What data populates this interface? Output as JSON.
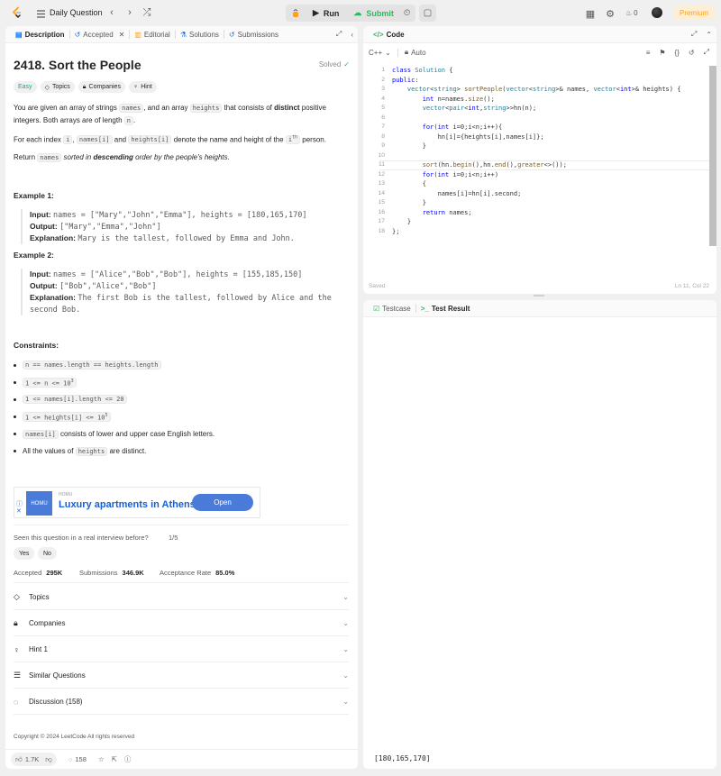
{
  "topbar": {
    "title": "Daily Question",
    "run_label": "Run",
    "submit_label": "Submit",
    "streak_count": "0",
    "premium_label": "Premium"
  },
  "left_tabs": [
    {
      "label": "Description"
    },
    {
      "label": "Accepted"
    },
    {
      "label": "Editorial"
    },
    {
      "label": "Solutions"
    },
    {
      "label": "Submissions"
    }
  ],
  "problem": {
    "title": "2418. Sort the People",
    "solved": "Solved",
    "difficulty": "Easy",
    "chip_topics": "Topics",
    "chip_companies": "Companies",
    "chip_hint": "Hint",
    "p1_a": "You are given an array of strings ",
    "p1_names": "names",
    "p1_b": ", and an array ",
    "p1_heights": "heights",
    "p1_c": " that consists of ",
    "p1_distinct": "distinct",
    "p1_d": " positive integers. Both arrays are of length ",
    "p1_n": "n",
    "p1_e": ".",
    "p2_a": "For each index ",
    "p2_i": "i",
    "p2_b": ", ",
    "p2_namesi": "names[i]",
    "p2_c": " and ",
    "p2_heightsi": "heights[i]",
    "p2_d": " denote the name and height of the ",
    "p2_ith": "i",
    "p2_th": "th",
    "p2_e": " person.",
    "p3_a": "Return ",
    "p3_names": "names",
    "p3_b": " sorted in ",
    "p3_desc": "descending",
    "p3_c": " order by the people's heights."
  },
  "examples": [
    {
      "heading": "Example 1:",
      "input_label": "Input:",
      "input": "names = [\"Mary\",\"John\",\"Emma\"], heights = [180,165,170]",
      "output_label": "Output:",
      "output": "[\"Mary\",\"Emma\",\"John\"]",
      "expl_label": "Explanation:",
      "explanation": "Mary is the tallest, followed by Emma and John."
    },
    {
      "heading": "Example 2:",
      "input_label": "Input:",
      "input": "names = [\"Alice\",\"Bob\",\"Bob\"], heights = [155,185,150]",
      "output_label": "Output:",
      "output": "[\"Bob\",\"Alice\",\"Bob\"]",
      "expl_label": "Explanation:",
      "explanation": "The first Bob is the tallest, followed by Alice and the",
      "explanation_2": "second Bob."
    }
  ],
  "constraints": {
    "heading": "Constraints:",
    "c1": "n == names.length == heights.length",
    "c2_code": "1 <= n <= 10",
    "c2_sup": "3",
    "c3": "1 <= names[i].length <= 20",
    "c4_code": "1 <= heights[i] <= 10",
    "c4_sup": "5",
    "c5_code": "names[i]",
    "c5_text": " consists of lower and upper case English letters.",
    "c6_a": "All the values of ",
    "c6_code": "heights",
    "c6_b": " are distinct."
  },
  "ad": {
    "logo": "HOMU",
    "brand": "HOMU",
    "headline": "Luxury apartments in Athens",
    "cta": "Open"
  },
  "interview": {
    "question": "Seen this question in a real interview before?",
    "count": "1/5",
    "yes": "Yes",
    "no": "No"
  },
  "stats": {
    "accepted_label": "Accepted",
    "accepted": "295K",
    "submissions_label": "Submissions",
    "submissions": "346.9K",
    "rate_label": "Acceptance Rate",
    "rate": "85.0%"
  },
  "accordion": [
    {
      "label": "Topics"
    },
    {
      "label": "Companies"
    },
    {
      "label": "Hint 1"
    },
    {
      "label": "Similar Questions"
    },
    {
      "label": "Discussion (158)"
    }
  ],
  "copyright": "Copyright © 2024 LeetCode All rights reserved",
  "footer": {
    "likes": "1.7K",
    "comments": "158"
  },
  "code_panel": {
    "title": "Code",
    "language": "C++",
    "mode": "Auto",
    "status_left": "Saved",
    "status_right": "Ln 11, Col 22",
    "line_numbers": [
      "1",
      "2",
      "3",
      "4",
      "5",
      "6",
      "7",
      "8",
      "9",
      "10",
      "11",
      "12",
      "13",
      "14",
      "15",
      "16",
      "17",
      "18"
    ],
    "lines": [
      "class Solution {",
      "public:",
      "    vector<string> sortPeople(vector<string>& names, vector<int>& heights) {",
      "        int n=names.size();",
      "        vector<pair<int,string>>hn(n);",
      "",
      "        for(int i=0;i<n;i++){",
      "            hn[i]={heights[i],names[i]};",
      "        }",
      "",
      "        sort(hn.begin(),hn.end(),greater<>());",
      "        for(int i=0;i<n;i++)",
      "        {",
      "            names[i]=hn[i].second;",
      "        }",
      "        return names;",
      "    }",
      "};"
    ]
  },
  "result_panel": {
    "tab_testcase": "Testcase",
    "tab_result": "Test Result",
    "input_value": "[180,165,170]"
  }
}
